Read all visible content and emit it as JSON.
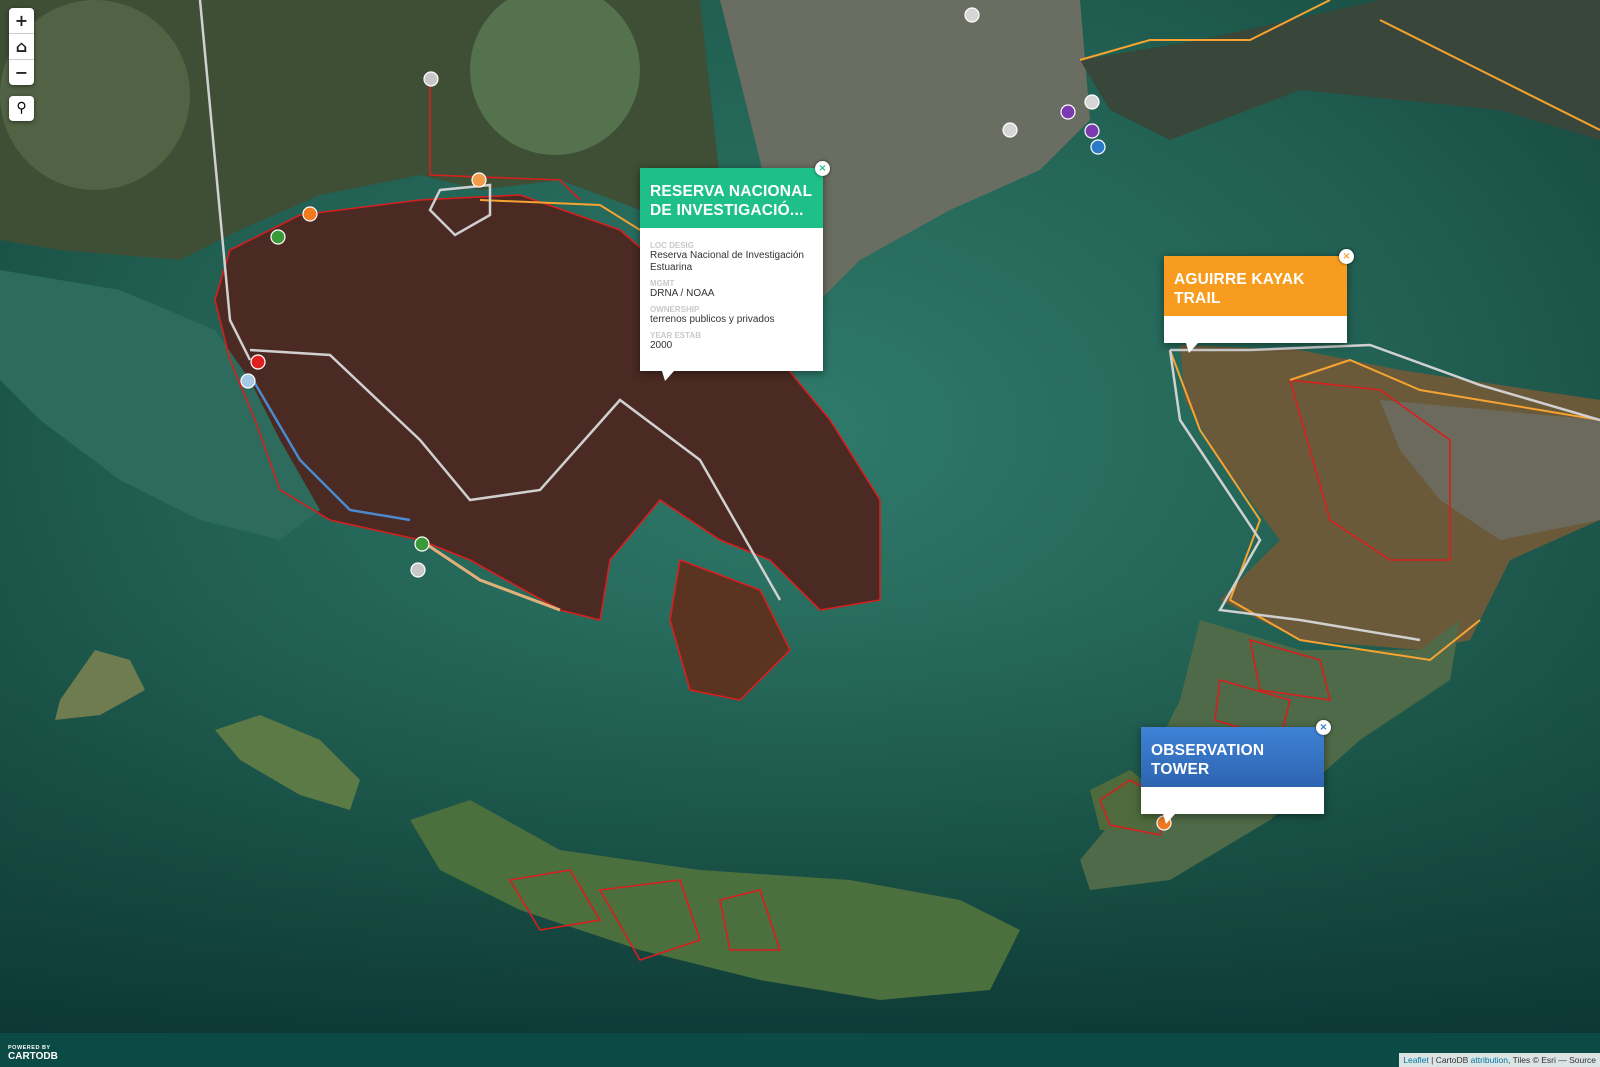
{
  "controls": {
    "zoom_in": "+",
    "home": "⌂",
    "zoom_out": "−",
    "locate": "⚲"
  },
  "popups": [
    {
      "title": "RESERVA NACIONAL DE INVESTIGACIÓ...",
      "color": "#1fbf8a",
      "fields": [
        {
          "label": "LOC DESIG",
          "value": "Reserva Nacional de Investigación Estuarina"
        },
        {
          "label": "MGMT",
          "value": "DRNA / NOAA"
        },
        {
          "label": "OWNERSHIP",
          "value": "terrenos publicos y privados"
        },
        {
          "label": "YEAR ESTAB",
          "value": "2000"
        }
      ]
    },
    {
      "title": "AGUIRRE KAYAK TRAIL",
      "color": "#f79c1e",
      "fields": []
    },
    {
      "title": "OBSERVATION TOWER",
      "color": "#3a76c7",
      "fields": []
    }
  ],
  "close_symbol": "×",
  "footer": {
    "powered_by": "POWERED BY",
    "brand": "CARTODB",
    "attr_leaflet": "Leaflet",
    "attr_sep1": " | CartoDB ",
    "attr_link": "attribution",
    "attr_rest": ", Tiles © Esri — Source"
  },
  "colors": {
    "water": "#1f6b58",
    "land": "#5a3a2a",
    "boundary_red": "#d81e1e",
    "trail_orange": "#f7a331",
    "trail_gray": "#cfcfcf",
    "trail_blue": "#4a8ad0"
  }
}
